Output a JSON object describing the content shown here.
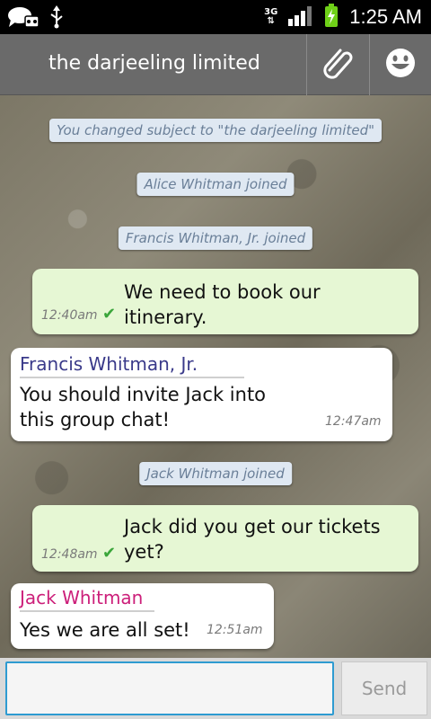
{
  "status_bar": {
    "network": "3G",
    "time": "1:25 AM"
  },
  "header": {
    "title": "the darjeeling limited",
    "attach_icon": "paperclip-icon",
    "emoji_icon": "smiley-icon"
  },
  "system_messages": [
    "You changed subject to \"the darjeeling limited\"",
    "Alice Whitman joined",
    "Francis Whitman, Jr. joined",
    "Jack Whitman joined"
  ],
  "messages": [
    {
      "direction": "out",
      "lines": [
        "We need to book our",
        "itinerary."
      ],
      "time": "12:40am",
      "status": "delivered"
    },
    {
      "direction": "in",
      "sender": "Francis Whitman, Jr.",
      "sender_color": "#3a3a8a",
      "lines": [
        "You should invite Jack into",
        "this group chat!"
      ],
      "time": "12:47am"
    },
    {
      "direction": "out",
      "lines": [
        "Jack did you get our tickets",
        "yet?"
      ],
      "time": "12:48am",
      "status": "delivered"
    },
    {
      "direction": "in",
      "sender": "Jack Whitman",
      "sender_color": "#cc1f7a",
      "lines": [
        "Yes we are all set!"
      ],
      "time": "12:51am"
    }
  ],
  "composer": {
    "input_value": "",
    "send_label": "Send"
  },
  "colors": {
    "header_bg": "#6a6a6a",
    "outgoing_bubble": "#e6f7d4",
    "incoming_bubble": "#ffffff",
    "system_bubble": "#dfe8f2",
    "input_focus": "#2e9bd1",
    "check": "#3aa53a"
  }
}
